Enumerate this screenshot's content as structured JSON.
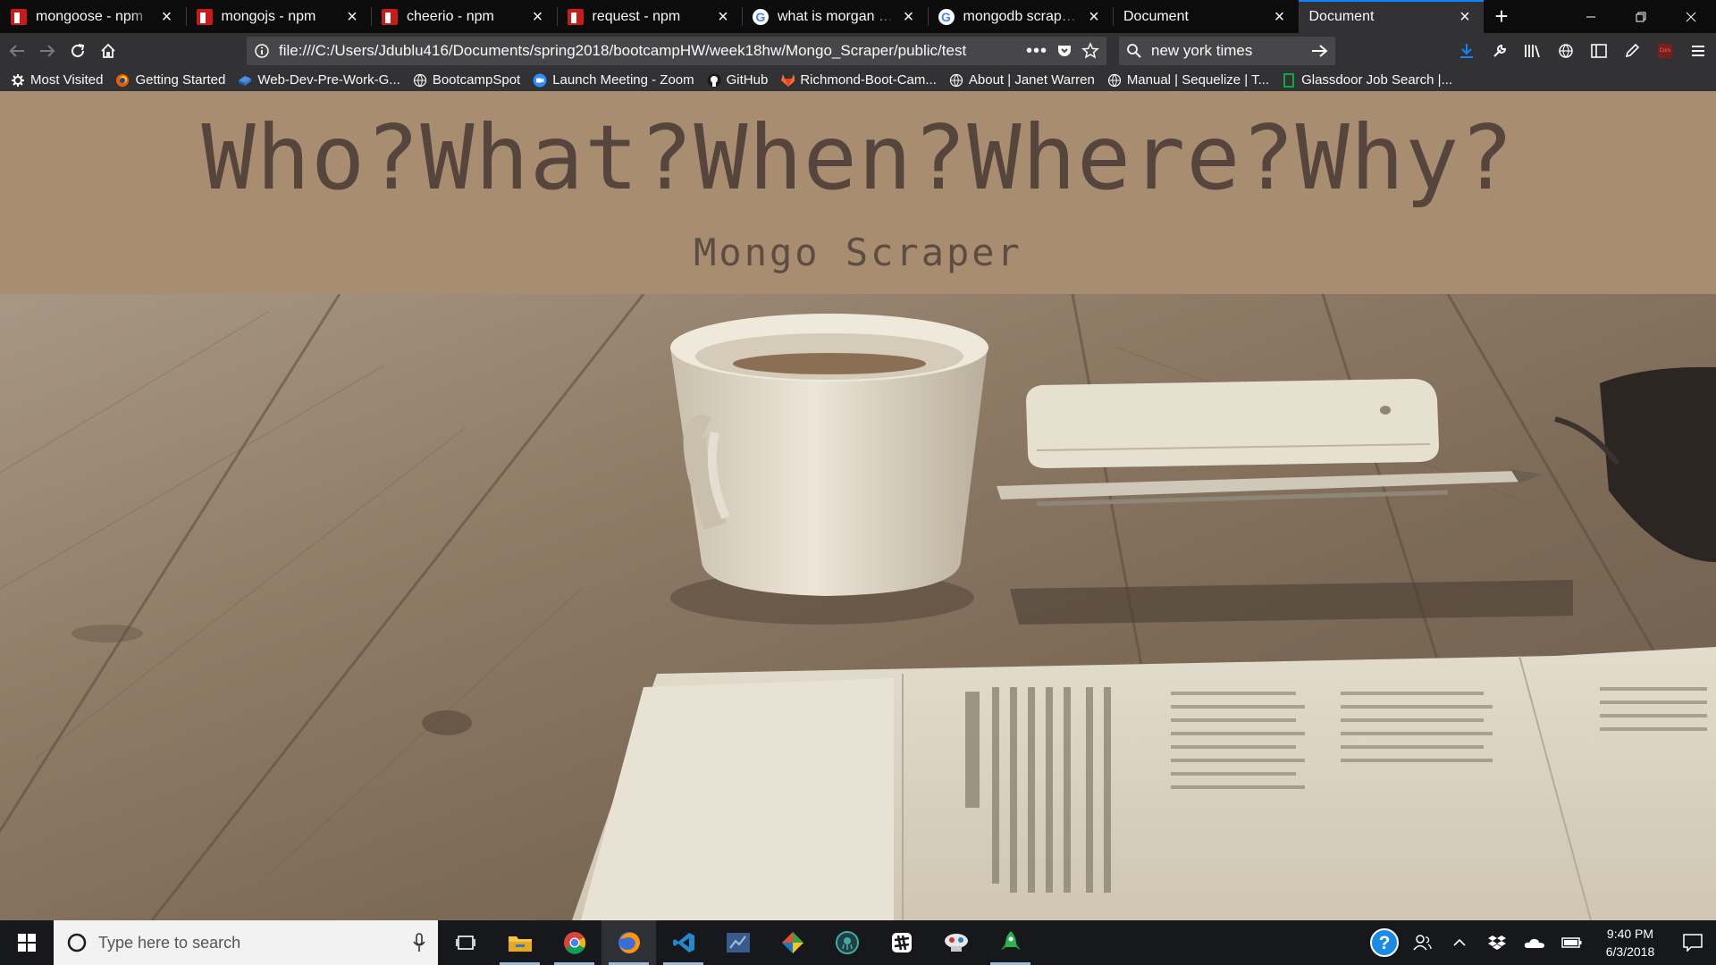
{
  "browser": {
    "tabs": [
      {
        "title": "mongoose - npm",
        "favicon": "npm-icon",
        "active": false
      },
      {
        "title": "mongojs - npm",
        "favicon": "npm-icon",
        "active": false
      },
      {
        "title": "cheerio - npm",
        "favicon": "npm-icon",
        "active": false
      },
      {
        "title": "request - npm",
        "favicon": "npm-icon",
        "active": false
      },
      {
        "title": "what is morgan whe",
        "favicon": "google-icon",
        "active": false
      },
      {
        "title": "mongodb scraper -",
        "favicon": "google-icon",
        "active": false
      },
      {
        "title": "Document",
        "favicon": "",
        "active": false
      },
      {
        "title": "Document",
        "favicon": "",
        "active": true
      }
    ],
    "url": "file:///C:/Users/Jdublu416/Documents/spring2018/bootcampHW/week18hw/Mongo_Scraper/public/test",
    "search_value": "new york times",
    "bookmarks": [
      {
        "label": "Most Visited",
        "icon": "gear-icon"
      },
      {
        "label": "Getting Started",
        "icon": "firefox-icon"
      },
      {
        "label": "Web-Dev-Pre-Work-G...",
        "icon": "cube-icon"
      },
      {
        "label": "BootcampSpot",
        "icon": "globe-icon"
      },
      {
        "label": "Launch Meeting - Zoom",
        "icon": "zoom-icon"
      },
      {
        "label": "GitHub",
        "icon": "github-icon"
      },
      {
        "label": "Richmond-Boot-Cam...",
        "icon": "gitlab-icon"
      },
      {
        "label": "About | Janet Warren",
        "icon": "globe-icon"
      },
      {
        "label": "Manual | Sequelize | T...",
        "icon": "globe-icon"
      },
      {
        "label": "Glassdoor Job Search |...",
        "icon": "glassdoor-icon"
      }
    ]
  },
  "page": {
    "title": "Who?What?When?Where?Why?",
    "subtitle": "Mongo Scraper"
  },
  "taskbar": {
    "search_placeholder": "Type here to search",
    "apps": [
      "task-view",
      "file-explorer",
      "chrome",
      "firefox",
      "vscode",
      "app-blue",
      "git-kraken",
      "gitkraken-dark",
      "slack",
      "robo3t",
      "atom-green"
    ],
    "time": "9:40 PM",
    "date": "6/3/2018"
  },
  "colors": {
    "header_bg": "#a98d71",
    "title_color": "#55453d",
    "tab_accent": "#0a84ff"
  }
}
